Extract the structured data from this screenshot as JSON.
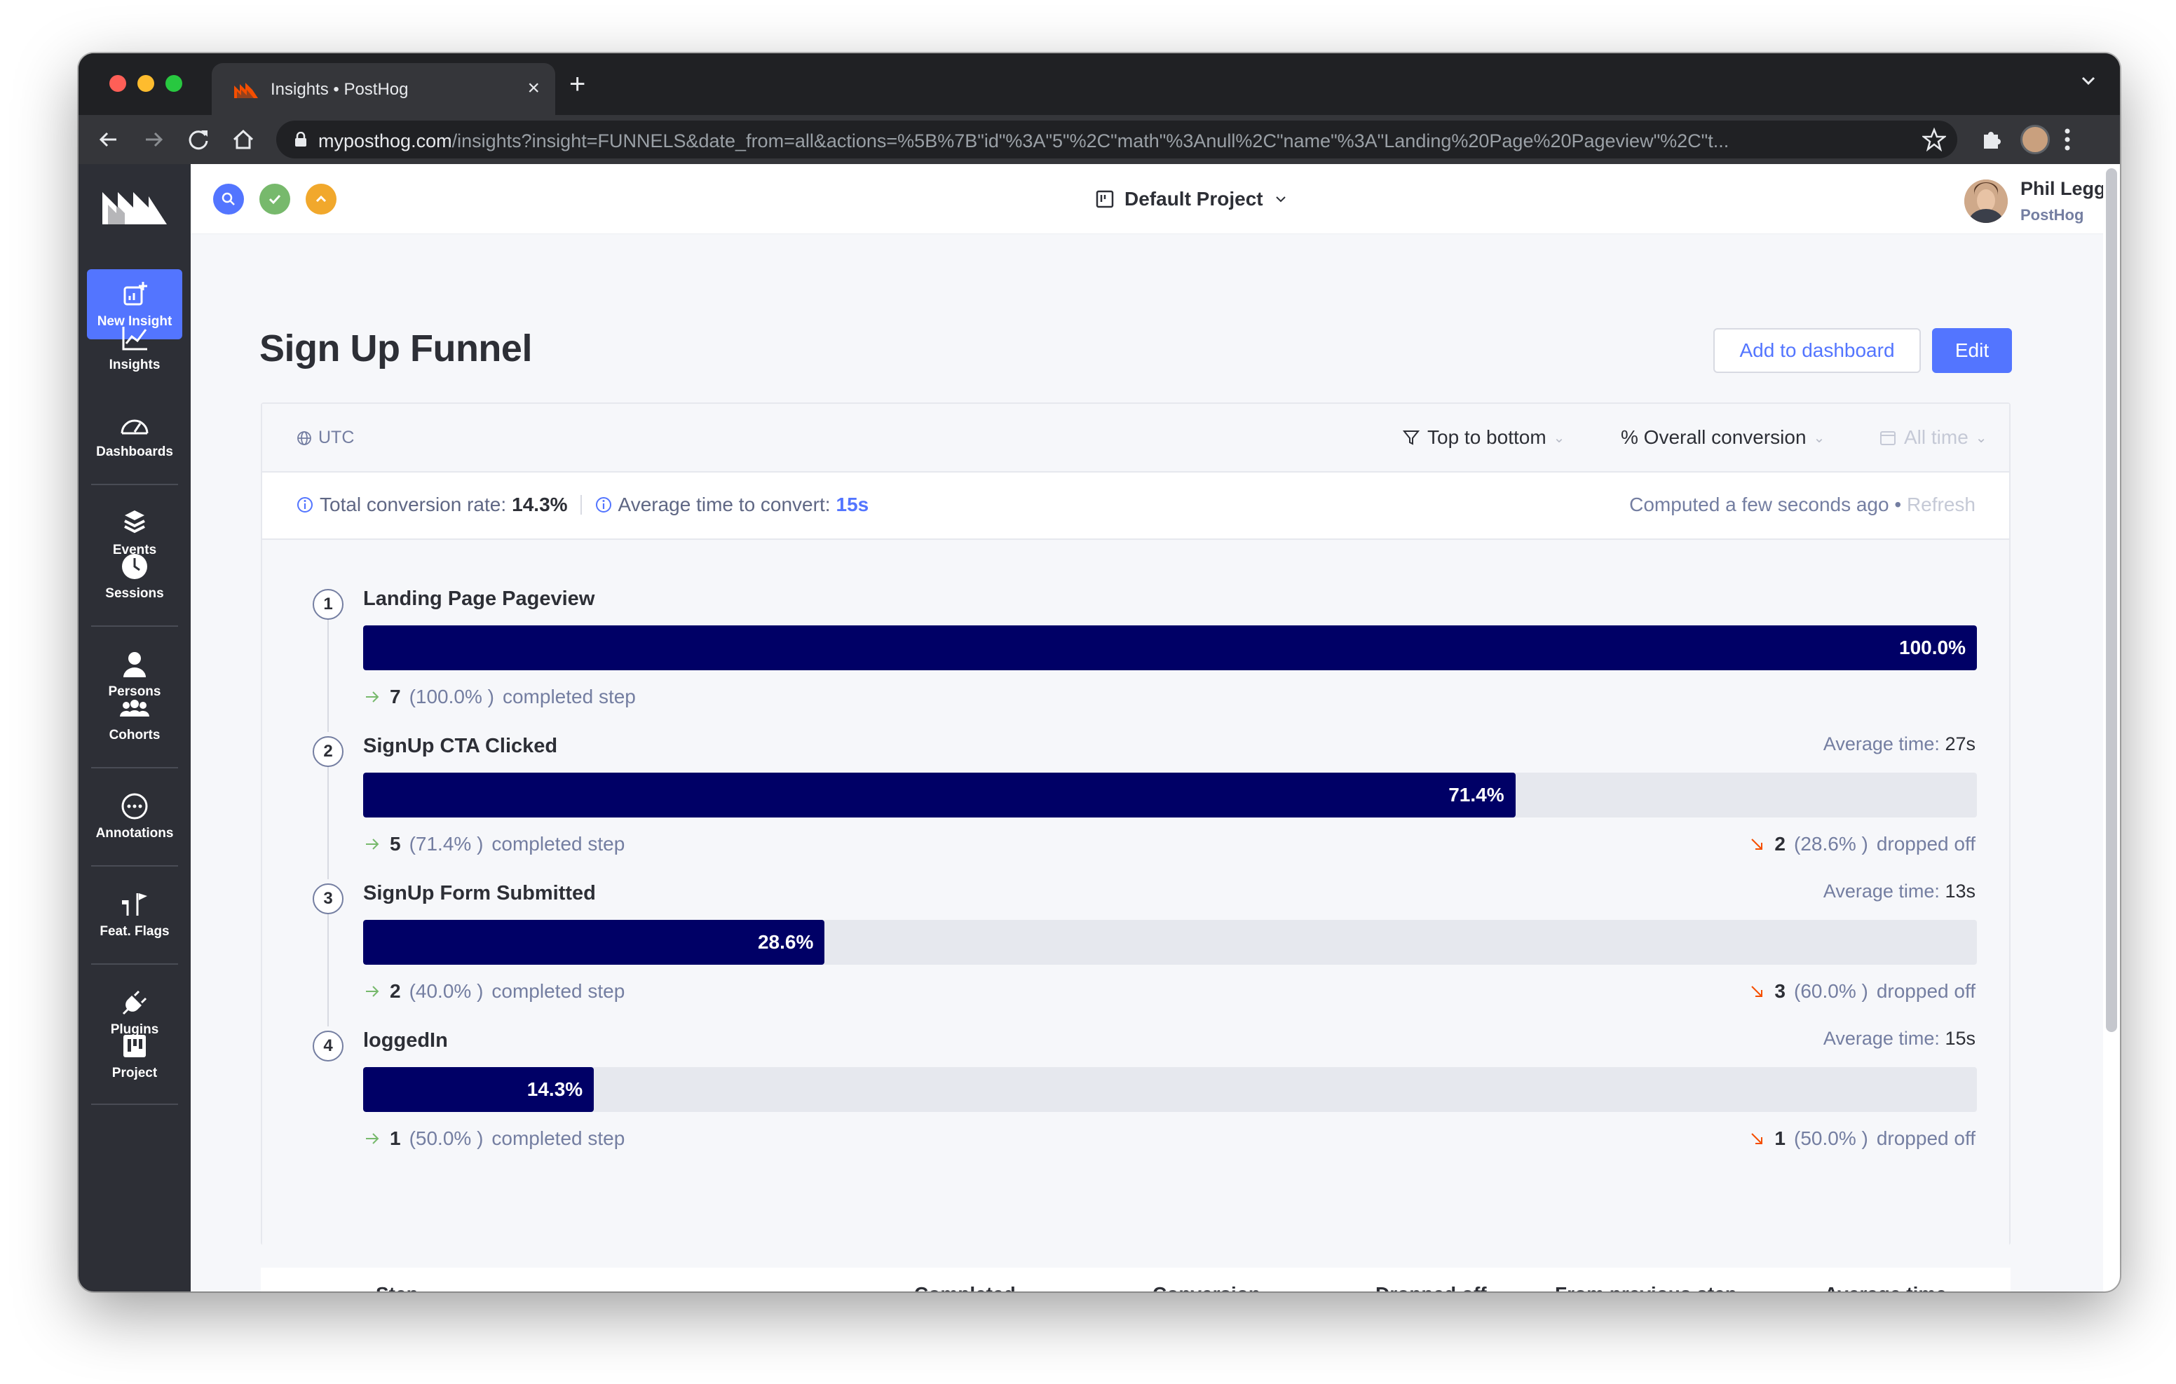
{
  "browser": {
    "tab_title": "Insights • PostHog",
    "new_tab_glyph": "+",
    "close_glyph": "×",
    "url_host": "myposthog.com",
    "url_path": "/insights?insight=FUNNELS&date_from=all&actions=%5B%7B\"id\"%3A\"5\"%2C\"math\"%3Anull%2C\"name\"%3A\"Landing%20Page%20Pageview\"%2C\"t..."
  },
  "sidebar": {
    "items": [
      {
        "label": "New Insight",
        "icon": "new-insight-icon"
      },
      {
        "label": "Insights",
        "icon": "insights-chart-icon"
      },
      {
        "label": "Dashboards",
        "icon": "dashboard-gauge-icon"
      },
      {
        "label": "Events",
        "icon": "events-stack-icon"
      },
      {
        "label": "Sessions",
        "icon": "clock-icon"
      },
      {
        "label": "Persons",
        "icon": "person-icon"
      },
      {
        "label": "Cohorts",
        "icon": "cohorts-icon"
      },
      {
        "label": "Annotations",
        "icon": "annotation-icon"
      },
      {
        "label": "Feat. Flags",
        "icon": "flag-icon"
      },
      {
        "label": "Plugins",
        "icon": "plug-icon"
      },
      {
        "label": "Project",
        "icon": "project-icon"
      }
    ]
  },
  "topbar": {
    "project": "Default Project",
    "user_name": "Phil Leggetter",
    "user_org": "PostHog",
    "status_colors": [
      "#5375ff",
      "#77b96c",
      "#f1a82c"
    ]
  },
  "page": {
    "title": "Sign Up Funnel",
    "add_to_dashboard": "Add to dashboard",
    "edit": "Edit"
  },
  "filters": {
    "timezone": "UTC",
    "order": "Top to bottom",
    "conversion": "% Overall conversion",
    "date": "All time"
  },
  "stats": {
    "total_label": "Total conversion rate:",
    "total_value": "14.3%",
    "avg_label": "Average time to convert:",
    "avg_value": "15s",
    "computed": "Computed a few seconds ago",
    "separator": "•",
    "refresh": "Refresh"
  },
  "funnel": {
    "completed_suffix": "completed step",
    "dropped_suffix": "dropped off",
    "avg_time_label": "Average time:",
    "steps": [
      {
        "num": "1",
        "name": "Landing Page Pageview",
        "pct": 100.0,
        "pct_label": "100.0%",
        "completed": "7",
        "completed_pct": "(100.0% )",
        "dropped": "",
        "dropped_pct": "",
        "avg_time": ""
      },
      {
        "num": "2",
        "name": "SignUp CTA Clicked",
        "pct": 71.4,
        "pct_label": "71.4%",
        "completed": "5",
        "completed_pct": "(71.4% )",
        "dropped": "2",
        "dropped_pct": "(28.6% )",
        "avg_time": "27s"
      },
      {
        "num": "3",
        "name": "SignUp Form Submitted",
        "pct": 28.6,
        "pct_label": "28.6%",
        "completed": "2",
        "completed_pct": "(40.0% )",
        "dropped": "3",
        "dropped_pct": "(60.0% )",
        "avg_time": "13s"
      },
      {
        "num": "4",
        "name": "loggedIn",
        "pct": 14.3,
        "pct_label": "14.3%",
        "completed": "1",
        "completed_pct": "(50.0% )",
        "dropped": "1",
        "dropped_pct": "(50.0% )",
        "avg_time": "15s"
      }
    ]
  },
  "table": {
    "headers": [
      "Step",
      "Completed",
      "Conversion",
      "Dropped off",
      "From previous step",
      "Average time"
    ]
  },
  "colors": {
    "accent": "#5375ff",
    "bar": "#000066",
    "sidebar": "#2d2f36",
    "completed_arrow": "#77b96c",
    "dropped_arrow": "#f54e00"
  }
}
